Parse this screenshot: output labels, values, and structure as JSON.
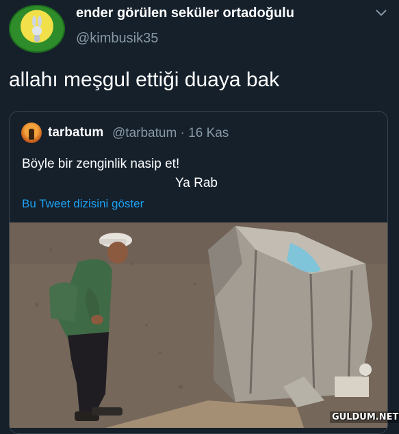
{
  "author": {
    "display_name": "ender görülen seküler ortadoğulu",
    "handle": "@kimbusik35",
    "avatar_icon": "bugs-bunny-badge-icon"
  },
  "tweet": {
    "text": "allahı meşgul ettiği duaya bak"
  },
  "quoted_tweet": {
    "display_name": "tarbatum",
    "meta": "@tarbatum · 16 Kas",
    "line1": "Böyle bir zenginlik nasip et!",
    "line2": "Ya Rab",
    "thread_link": "Bu Tweet dizisini göster",
    "media_description_icon": "photo-man-with-large-sack"
  },
  "watermark": "GULDUM.NET",
  "colors": {
    "background": "#15202b",
    "secondary_text": "#8899a6",
    "link": "#1da1f2",
    "border": "#38444d"
  }
}
